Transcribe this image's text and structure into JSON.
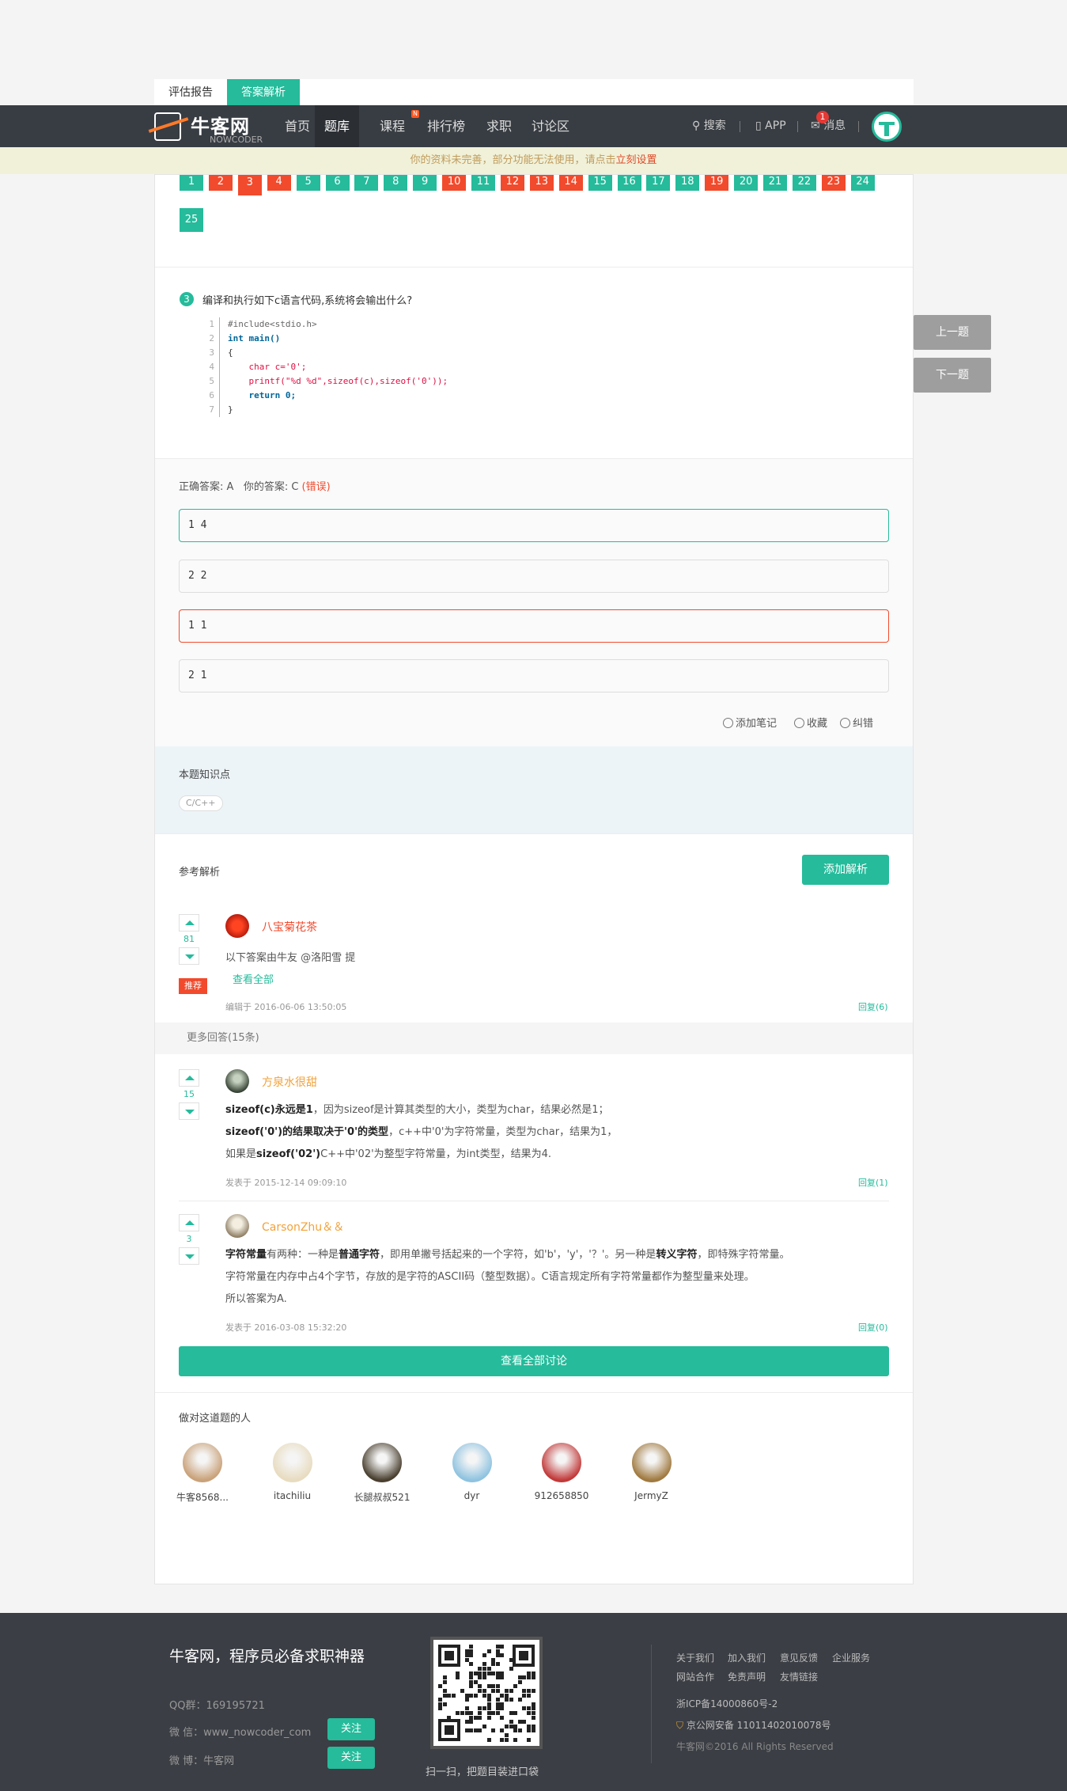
{
  "tabs": [
    {
      "label": "评估报告",
      "active": false
    },
    {
      "label": "答案解析",
      "active": true
    }
  ],
  "nav": {
    "logo_cn": "牛客网",
    "logo_en": "NOWCODER",
    "links": [
      "首页",
      "题库",
      "课程",
      "排行榜",
      "求职",
      "讨论区"
    ],
    "active": "题库",
    "course_badge": "N",
    "search": "搜索",
    "app": "APP",
    "messages": "消息",
    "message_count": "1"
  },
  "warning": {
    "text": "你的资料未完善，部分功能无法使用，请点击",
    "link": "立刻设置"
  },
  "question_numbers": [
    {
      "n": "1",
      "status": "correct"
    },
    {
      "n": "2",
      "status": "wrong"
    },
    {
      "n": "3",
      "status": "wrong",
      "current": true
    },
    {
      "n": "4",
      "status": "wrong"
    },
    {
      "n": "5",
      "status": "correct"
    },
    {
      "n": "6",
      "status": "correct"
    },
    {
      "n": "7",
      "status": "correct"
    },
    {
      "n": "8",
      "status": "correct"
    },
    {
      "n": "9",
      "status": "correct"
    },
    {
      "n": "10",
      "status": "wrong"
    },
    {
      "n": "11",
      "status": "correct"
    },
    {
      "n": "12",
      "status": "wrong"
    },
    {
      "n": "13",
      "status": "wrong"
    },
    {
      "n": "14",
      "status": "wrong"
    },
    {
      "n": "15",
      "status": "correct"
    },
    {
      "n": "16",
      "status": "correct"
    },
    {
      "n": "17",
      "status": "correct"
    },
    {
      "n": "18",
      "status": "correct"
    },
    {
      "n": "19",
      "status": "wrong"
    },
    {
      "n": "20",
      "status": "correct"
    },
    {
      "n": "21",
      "status": "correct"
    },
    {
      "n": "22",
      "status": "correct"
    },
    {
      "n": "23",
      "status": "wrong"
    },
    {
      "n": "24",
      "status": "correct"
    },
    {
      "n": "25",
      "status": "correct"
    }
  ],
  "question": {
    "number": "3",
    "text": "编译和执行如下c语言代码,系统将会输出什么?",
    "code_lines": [
      [
        "1",
        "#include<stdio.h>"
      ],
      [
        "2",
        "int main()"
      ],
      [
        "3",
        "{"
      ],
      [
        "4",
        "    char c='0';"
      ],
      [
        "5",
        "    printf(\"%d %d\",sizeof(c),sizeof('0'));"
      ],
      [
        "6",
        "    return 0;"
      ],
      [
        "7",
        "}"
      ]
    ]
  },
  "answer": {
    "correct_label": "正确答案: A",
    "yours_label": "你的答案: C",
    "result": "(错误)"
  },
  "options": [
    {
      "text": "1 4",
      "state": "right"
    },
    {
      "text": "2 2",
      "state": "normal"
    },
    {
      "text": "1 1",
      "state": "wrong"
    },
    {
      "text": "2 1",
      "state": "normal"
    }
  ],
  "tools": {
    "note": "添加笔记",
    "fav": "收藏",
    "fix": "纠错"
  },
  "knowledge": {
    "title": "本题知识点",
    "tag": "C/C++"
  },
  "analysis": {
    "title": "参考解析",
    "add_button": "添加解析"
  },
  "top_answer": {
    "votes": "81",
    "user": "八宝菊花茶",
    "text": "以下答案由牛友 @洛阳雪 提",
    "view_all": "查看全部",
    "badge": "推荐",
    "meta": "编辑于 2016-06-06 13:50:05",
    "reply": "回复(6)"
  },
  "more_answers_label": "更多回答(15条)",
  "answers": [
    {
      "votes": "15",
      "user": "方泉水很甜",
      "lines": [
        [
          "sizeof(c)永远是1",
          "，因为sizeof是计算其类型的大小，类型为char，结果必然是1；"
        ],
        [
          "sizeof('0')的结果取决于'0'的类型",
          "，c++中'0'为字符常量，类型为char，结果为1，"
        ],
        [
          "如果是",
          "sizeof('02')",
          "C++中'02'为整型字符常量，为int类型，结果为4."
        ]
      ],
      "meta": "发表于 2015-12-14 09:09:10",
      "reply": "回复(1)"
    },
    {
      "votes": "3",
      "user": "CarsonZhu＆＆",
      "line1": [
        "字符常量",
        "有两种：一种是",
        "普通字符",
        "，即用单撇号括起来的一个字符，如'b'，'y'，'？'。另一种是",
        "转义字符",
        "，即特殊字符常量。"
      ],
      "line2": "字符常量在内存中占4个字节，存放的是字符的ASCII码（整型数据）。C语言规定所有字符常量都作为整型量来处理。",
      "line3": "所以答案为A.",
      "meta": "发表于 2016-03-08 15:32:20",
      "reply": "回复(0)"
    }
  ],
  "view_all_discussion": "查看全部讨论",
  "correct_people": {
    "title": "做对这道题的人",
    "people": [
      {
        "name": "牛客8568...",
        "color": "#c9a27a"
      },
      {
        "name": "itachiliu",
        "color": "#e8dcc0"
      },
      {
        "name": "长腿叔叔521",
        "color": "#4a4030"
      },
      {
        "name": "dyr",
        "color": "#8fc3e0"
      },
      {
        "name": "912658850",
        "color": "#c23a3a"
      },
      {
        "name": "JermyZ",
        "color": "#a07a40"
      }
    ]
  },
  "side_buttons": {
    "prev": "上一题",
    "next": "下一题"
  },
  "footer": {
    "slogan": "牛客网，程序员必备求职神器",
    "qq": "QQ群：169195721",
    "wechat": "微 信：www_nowcoder_com",
    "weibo": "微 博：牛客网",
    "follow": "关注",
    "qr_caption": "扫一扫，把题目装进口袋",
    "links_row1": [
      "关于我们",
      "加入我们",
      "意见反馈",
      "企业服务"
    ],
    "links_row2": [
      "网站合作",
      "免责声明",
      "友情链接"
    ],
    "icp": "浙ICP备14000860号-2",
    "police": "京公网安备 11011402010078号",
    "copyright": "牛客网©2016 All Rights Reserved"
  }
}
